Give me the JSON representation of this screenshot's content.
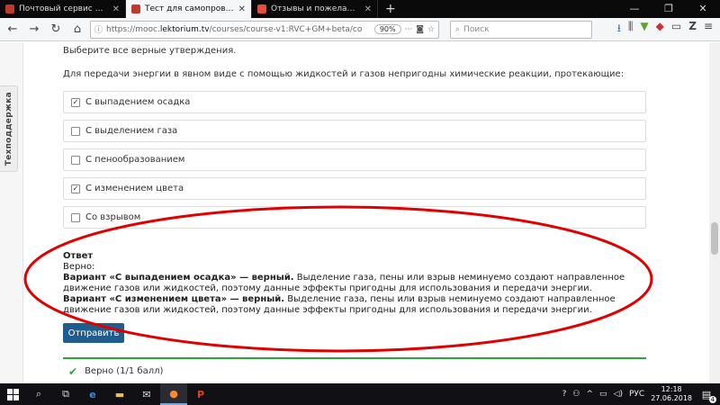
{
  "browser": {
    "tabs": [
      {
        "title": "Почтовый сервис РХТУ им. Д. И.",
        "color": "#c0392b",
        "active": false
      },
      {
        "title": "Тест для самопроверки | 2.3.",
        "color": "#c0392b",
        "active": true
      },
      {
        "title": "Отзывы и пожелания | Лектор",
        "color": "#e74c3c",
        "active": false
      }
    ],
    "url_prefix": "https://mooc.",
    "url_domain": "lektorium.tv",
    "url_rest": "/courses/course-v1:RVC+GM+beta/co",
    "zoom": "90%",
    "search_placeholder": "Поиск"
  },
  "sidebar": {
    "support_label": "Техподдержка"
  },
  "problem": {
    "instruction": "Выберите все верные утверждения.",
    "question": "Для передачи энергии в явном виде с помощью жидкостей и газов непригодны химические реакции, протекающие:",
    "options": [
      {
        "label": "С выпадением осадка",
        "checked": true
      },
      {
        "label": "С выделением газа",
        "checked": false
      },
      {
        "label": "С пенообразованием",
        "checked": false
      },
      {
        "label": "С изменением цвета",
        "checked": true
      },
      {
        "label": "Со взрывом",
        "checked": false
      }
    ],
    "answer": {
      "title": "Ответ",
      "status": "Верно:",
      "variant1_bold": "Вариант «С выпадением осадка» — верный.",
      "variant1_text": " Выделение газа, пены или взрыв неминуемо создают направленное движение газов или жидкостей, поэтому данные эффекты пригодны для использования и передачи энергии.",
      "variant2_bold": "Вариант «С изменением цвета» — верный.",
      "variant2_text": " Выделение газа, пены или взрыв неминуемо создают направленное движение газов или жидкостей, поэтому данные эффекты пригодны для использования и передачи энергии."
    },
    "submit_label": "Отправить",
    "result_label": "Верно (1/1 балл)"
  },
  "taskbar": {
    "language": "РУС",
    "time": "12:18",
    "date": "27.06.2018",
    "notifications": "4"
  },
  "colors": {
    "accent": "#1e5d8d",
    "success": "#2aa63b",
    "highlight_ellipse": "#e00000"
  }
}
